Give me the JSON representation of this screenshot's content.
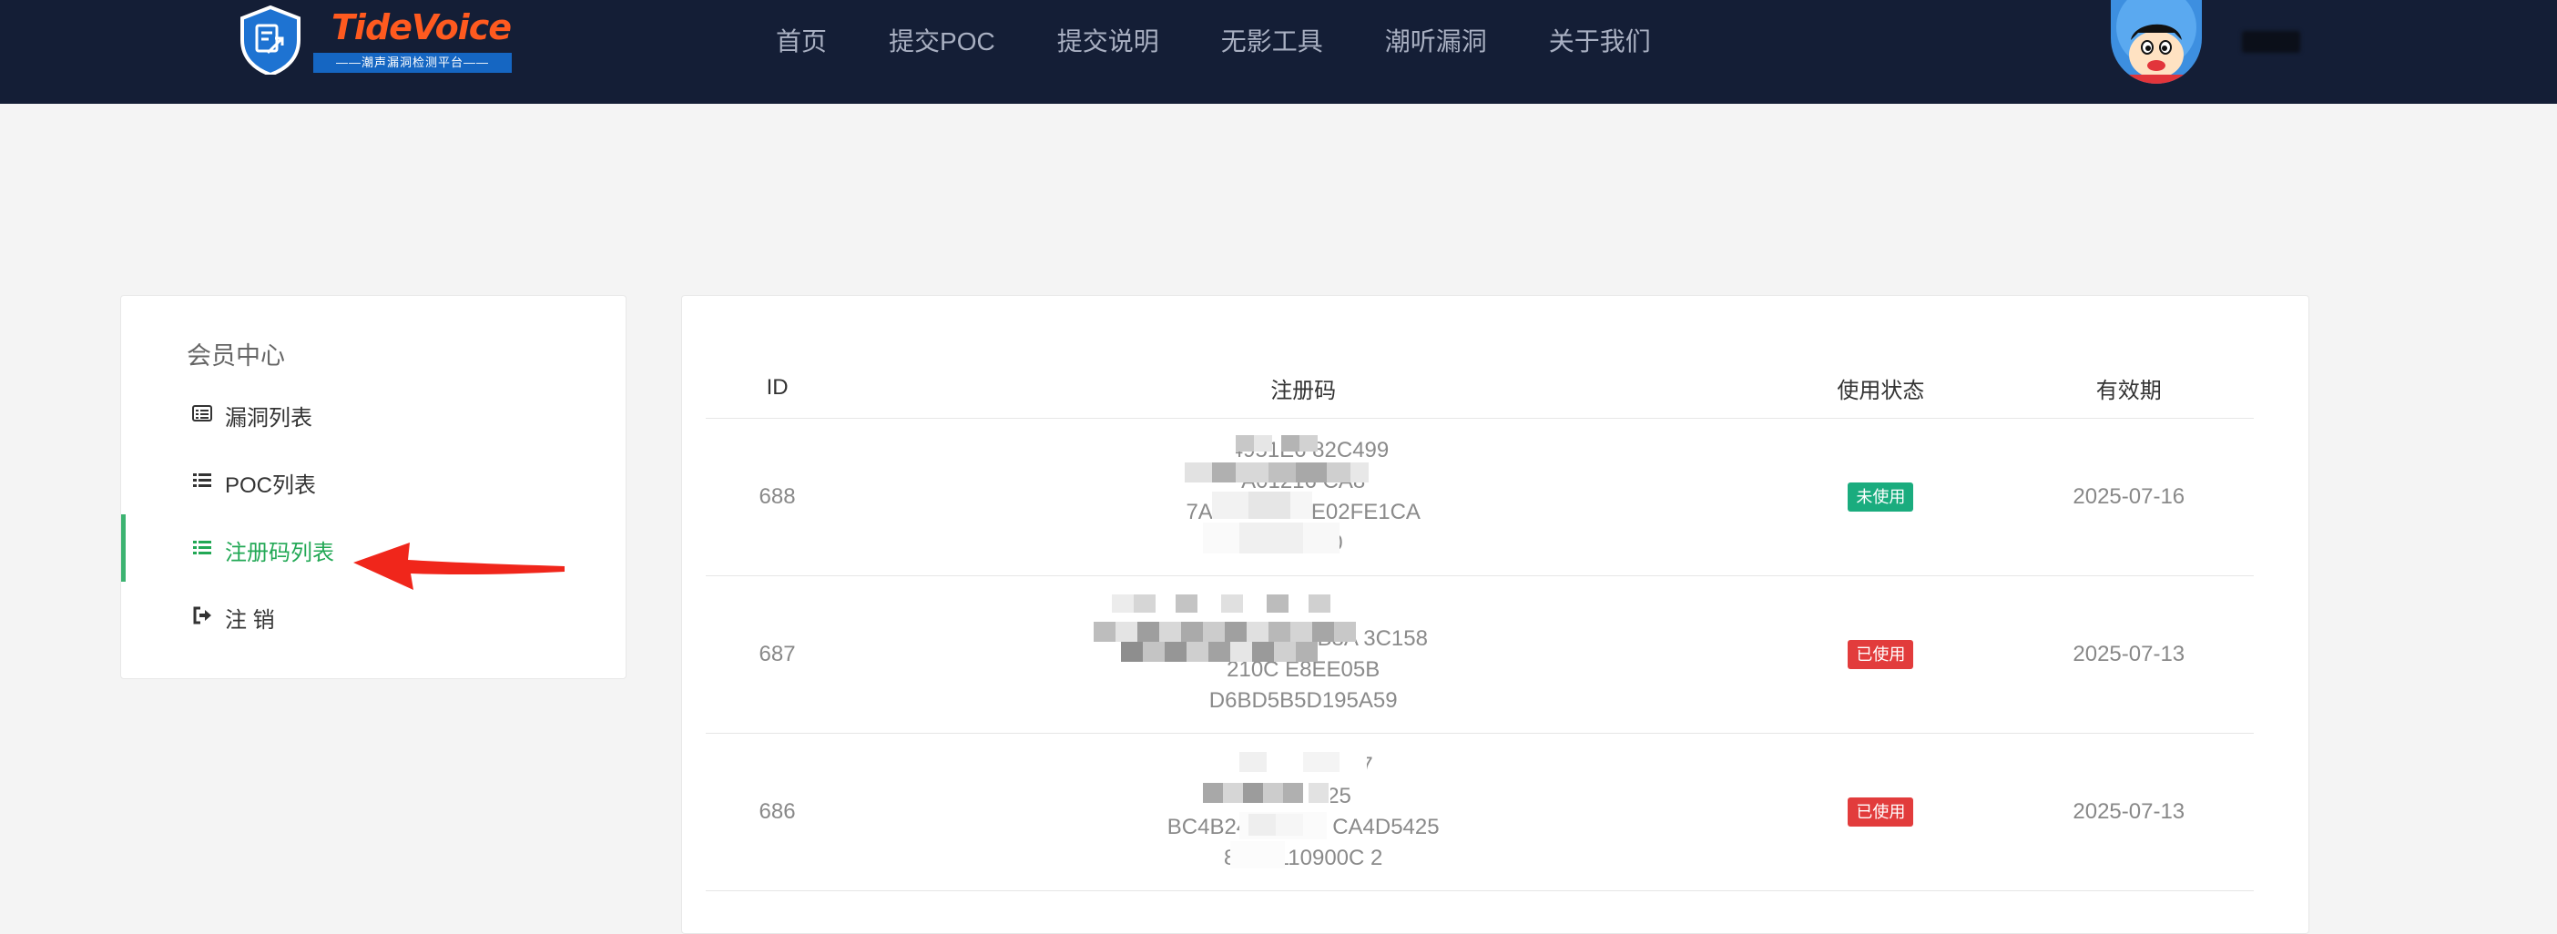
{
  "header": {
    "logo": {
      "title": "TideVoice",
      "subtitle": "——潮声漏洞检测平台——"
    },
    "nav": [
      "首页",
      "提交POC",
      "提交说明",
      "无影工具",
      "潮听漏洞",
      "关于我们"
    ]
  },
  "sidebar": {
    "title": "会员中心",
    "items": [
      {
        "label": "漏洞列表",
        "icon": "list-box-icon",
        "active": false
      },
      {
        "label": "POC列表",
        "icon": "list-icon",
        "active": false
      },
      {
        "label": "注册码列表",
        "icon": "list-icon",
        "active": true
      },
      {
        "label": "注 销",
        "icon": "sign-out-icon",
        "active": false
      }
    ]
  },
  "table": {
    "headers": {
      "id": "ID",
      "code": "注册码",
      "status": "使用状态",
      "date": "有效期"
    },
    "rows": [
      {
        "id": "688",
        "code_lines": [
          "F4951E6  82C499",
          "A01216  CA8",
          "7A3853  DC4E02FE1CA",
          "8066  10"
        ],
        "status": "未使用",
        "status_color": "#1aac7e",
        "date": "2025-07-16"
      },
      {
        "id": "687",
        "code_lines": [
          "868B1",
          "1E083138E79B8A  3C158",
          "210C  E8EE05B",
          "D6BD5B5D195A59"
        ],
        "status": "已使用",
        "status_color": "#e23c3c",
        "date": "2025-07-13"
      },
      {
        "id": "686",
        "code_lines": [
          "0934746A  117",
          "C41F0  25",
          "BC4B24270D5F  CA4D5425",
          "8B9E110900C  2"
        ],
        "status": "已使用",
        "status_color": "#e23c3c",
        "date": "2025-07-13"
      }
    ]
  },
  "colors": {
    "header_bg": "#141e36",
    "active_accent": "#3cb371",
    "arrow": "#f0261b"
  }
}
